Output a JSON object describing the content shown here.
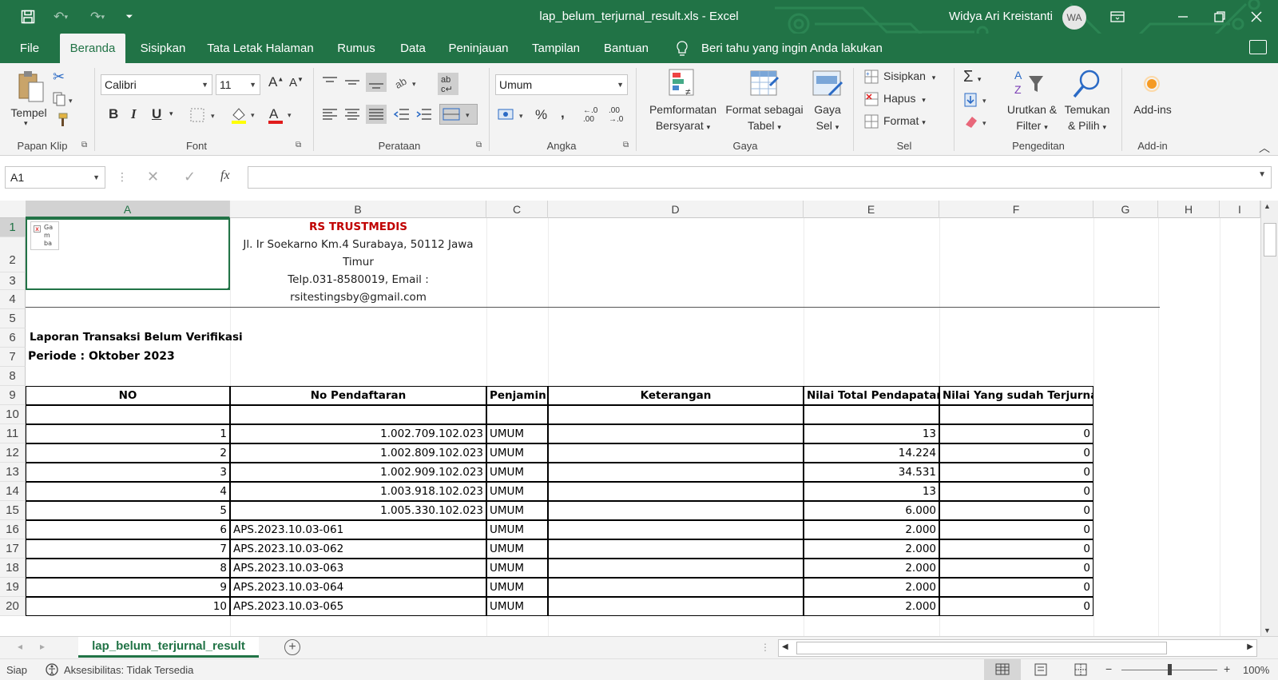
{
  "titlebar": {
    "document_title": "lap_belum_terjurnal_result.xls  -  Excel",
    "user_name": "Widya Ari Kreistanti",
    "user_initials": "WA"
  },
  "menu": {
    "tabs": [
      "File",
      "Beranda",
      "Sisipkan",
      "Tata Letak Halaman",
      "Rumus",
      "Data",
      "Peninjauan",
      "Tampilan",
      "Bantuan"
    ],
    "active_tab": "Beranda",
    "tell_me": "Beri tahu yang ingin Anda lakukan"
  },
  "ribbon": {
    "clipboard": {
      "paste_label": "Tempel",
      "group": "Papan Klip"
    },
    "font": {
      "name": "Calibri",
      "size": "11",
      "group": "Font"
    },
    "alignment": {
      "group": "Perataan"
    },
    "number": {
      "format": "Umum",
      "group": "Angka"
    },
    "styles": {
      "conditional_l1": "Pemformatan",
      "conditional_l2": "Bersyarat",
      "format_table_l1": "Format sebagai",
      "format_table_l2": "Tabel",
      "cell_styles_l1": "Gaya",
      "cell_styles_l2": "Sel",
      "group": "Gaya"
    },
    "cells": {
      "insert": "Sisipkan",
      "delete": "Hapus",
      "format": "Format",
      "group": "Sel"
    },
    "editing": {
      "sort_l1": "Urutkan &",
      "sort_l2": "Filter",
      "find_l1": "Temukan",
      "find_l2": "& Pilih",
      "group": "Pengeditan"
    },
    "addins": {
      "label": "Add-ins",
      "group": "Add-in"
    }
  },
  "formula_bar": {
    "name_box": "A1",
    "fx": "fx",
    "value": ""
  },
  "grid": {
    "columns": [
      "A",
      "B",
      "C",
      "D",
      "E",
      "F",
      "G",
      "H",
      "I"
    ],
    "row_numbers": [
      "1",
      "2",
      "3",
      "4",
      "5",
      "6",
      "7",
      "8",
      "9",
      "10",
      "11",
      "12",
      "13",
      "14",
      "15",
      "16",
      "17",
      "18",
      "19",
      "20"
    ],
    "image_placeholder": "Ga m ba",
    "header": {
      "company": "RS TRUSTMEDIS",
      "address_l1": "Jl. Ir Soekarno Km.4 Surabaya, 50112 Jawa",
      "address_l2": "Timur",
      "contact_l1": "Telp.031-8580019, Email :",
      "contact_l2": "rsitestingsby@gmail.com"
    },
    "report_title": "Laporan Transaksi Belum Verifikasi",
    "report_period": "Periode : Oktober 2023",
    "table_headers": [
      "NO",
      "No Pendaftaran",
      "Penjamin",
      "Keterangan",
      "Nilai Total Pendapatan",
      "Nilai Yang sudah Terjurnal"
    ],
    "rows": [
      [
        "1",
        "1.002.709.102.023",
        "UMUM",
        "",
        "13",
        "0"
      ],
      [
        "2",
        "1.002.809.102.023",
        "UMUM",
        "",
        "14.224",
        "0"
      ],
      [
        "3",
        "1.002.909.102.023",
        "UMUM",
        "",
        "34.531",
        "0"
      ],
      [
        "4",
        "1.003.918.102.023",
        "UMUM",
        "",
        "13",
        "0"
      ],
      [
        "5",
        "1.005.330.102.023",
        "UMUM",
        "",
        "6.000",
        "0"
      ],
      [
        "6",
        "APS.2023.10.03-061",
        "UMUM",
        "",
        "2.000",
        "0"
      ],
      [
        "7",
        "APS.2023.10.03-062",
        "UMUM",
        "",
        "2.000",
        "0"
      ],
      [
        "8",
        "APS.2023.10.03-063",
        "UMUM",
        "",
        "2.000",
        "0"
      ],
      [
        "9",
        "APS.2023.10.03-064",
        "UMUM",
        "",
        "2.000",
        "0"
      ],
      [
        "10",
        "APS.2023.10.03-065",
        "UMUM",
        "",
        "2.000",
        "0"
      ]
    ]
  },
  "sheets": {
    "active": "lap_belum_terjurnal_result"
  },
  "status": {
    "ready": "Siap",
    "accessibility": "Aksesibilitas: Tidak Tersedia",
    "zoom": "100%"
  },
  "colors": {
    "excel_green": "#217346",
    "company_red": "#c00000"
  }
}
